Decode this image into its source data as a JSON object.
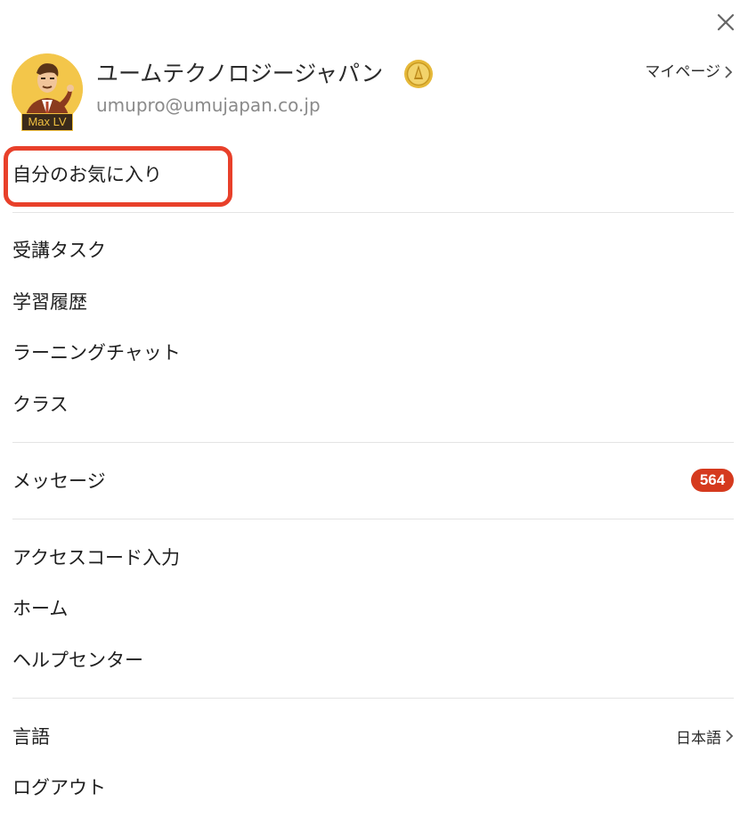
{
  "header": {
    "close_icon": "close-icon"
  },
  "profile": {
    "company_name": "ユームテクノロジージャパン",
    "email": "umupro@umujapan.co.jp",
    "level_badge": "Max LV",
    "mypage_label": "マイページ",
    "medal_icon": "gold-medal-icon",
    "colors": {
      "avatar_bg": "#f3c64a",
      "medal": "#e6b93a"
    }
  },
  "menu": {
    "favorites": "自分のお気に入り",
    "tasks": "受講タスク",
    "history": "学習履歴",
    "learning_chat": "ラーニングチャット",
    "class": "クラス",
    "messages": "メッセージ",
    "messages_count": "564",
    "access_code": "アクセスコード入力",
    "home": "ホーム",
    "help_center": "ヘルプセンター",
    "language": "言語",
    "language_value": "日本語",
    "logout": "ログアウト"
  },
  "colors": {
    "highlight": "#e8402a",
    "badge": "#d53a1e",
    "divider": "#e4e4e4"
  }
}
